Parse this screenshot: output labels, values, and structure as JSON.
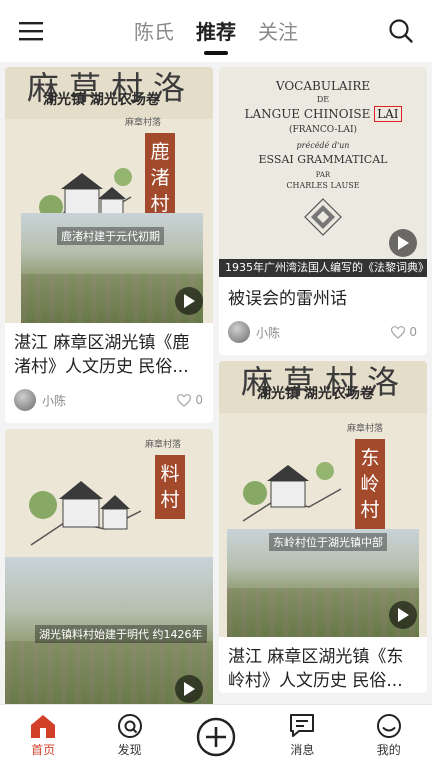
{
  "header": {
    "tabs": [
      {
        "label": "陈氏",
        "active": false
      },
      {
        "label": "推荐",
        "active": true
      },
      {
        "label": "关注",
        "active": false
      }
    ]
  },
  "feed": {
    "left": [
      {
        "cover": {
          "head_big": "麻草村洛",
          "head_small": "湖光镇 湖光农场卷",
          "vertical_title": "鹿渚村",
          "subtitle": "麻章村落",
          "photo_caption": "鹿渚村建于元代初期"
        },
        "title": "湛江 麻章区湖光镇《鹿渚村》人文历史 民俗...",
        "author": "小陈",
        "likes": "0"
      },
      {
        "cover": {
          "vertical_title": "料村",
          "subtitle": "麻章村落",
          "photo_caption": "湖光镇料村始建于明代 约1426年"
        },
        "title": ""
      }
    ],
    "right": [
      {
        "cover": {
          "line1": "VOCABULAIRE",
          "line2": "DE",
          "line3a": "LANGUE CHINOISE",
          "line3b": "LAI",
          "line4": "(FRANCO-LAI)",
          "line5": "précédé d'un",
          "line6": "ESSAI GRAMMATICAL",
          "line7": "PAR",
          "line8": "CHARLES LAUSE",
          "bottom_caption": "1935年广州湾法国人编写的《法黎词典》"
        },
        "title": "被误会的雷州话",
        "author": "小陈",
        "likes": "0"
      },
      {
        "cover": {
          "head_big": "麻草村洛",
          "head_small": "湖光镇 湖光农场卷",
          "vertical_title": "东岭村",
          "subtitle": "麻章村落",
          "photo_caption": "东岭村位于湖光镇中部"
        },
        "title": "湛江 麻章区湖光镇《东岭村》人文历史 民俗..."
      }
    ]
  },
  "bottom_nav": [
    {
      "label": "首页",
      "icon": "home-icon",
      "active": true
    },
    {
      "label": "发现",
      "icon": "discover-icon",
      "active": false
    },
    {
      "label": "",
      "icon": "add-icon",
      "active": false
    },
    {
      "label": "消息",
      "icon": "message-icon",
      "active": false
    },
    {
      "label": "我的",
      "icon": "profile-icon",
      "active": false
    }
  ],
  "colors": {
    "accent": "#d2402a",
    "cover_red": "#a44a2c"
  }
}
